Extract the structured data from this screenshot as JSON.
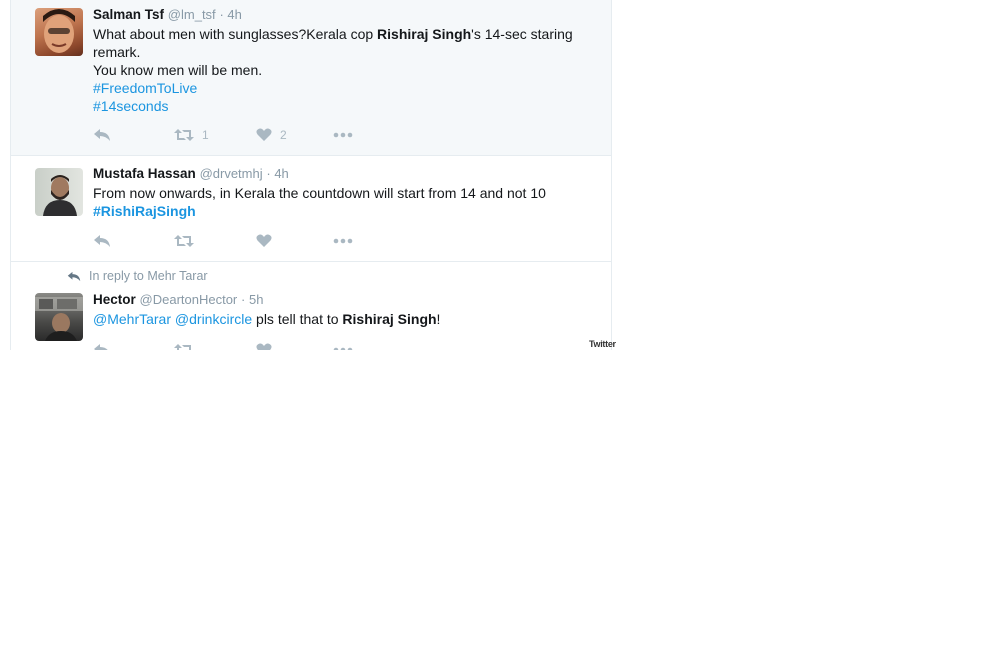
{
  "tweets": [
    {
      "name": "Salman Tsf",
      "handle": "@lm_tsf",
      "time": "· 4h",
      "text_pre": "What about men with sunglasses?Kerala cop ",
      "text_bold": "Rishiraj Singh",
      "text_post": "'s 14-sec staring remark.",
      "text_line2": "You know men will be men.",
      "hashtags": [
        "#FreedomToLive",
        "#14seconds"
      ],
      "retweets": "1",
      "likes": "2"
    },
    {
      "name": "Mustafa Hassan",
      "handle": "@drvetmhj",
      "time": "· 4h",
      "text": "From now onwards, in Kerala the countdown will start from 14 and not 10",
      "hashtag": "#RishiRajSingh"
    },
    {
      "reply_context": "In reply to Mehr Tarar",
      "name": "Hector",
      "handle": "@DeartonHector",
      "time": "· 5h",
      "mention1": "@MehrTarar",
      "mention2": "@drinkcircle",
      "text_mid": " pls tell that to ",
      "text_bold": "Rishiraj Singh",
      "text_end": "!"
    }
  ],
  "icons": {
    "reply": "reply-icon",
    "retweet": "retweet-icon",
    "like": "heart-icon",
    "more": "more-icon"
  },
  "watermark": "Twitter",
  "colors": {
    "link": "#1b95e0",
    "muted": "#8899a6",
    "icon": "#aab8c2",
    "highlight_bg": "#f5f8fa"
  }
}
